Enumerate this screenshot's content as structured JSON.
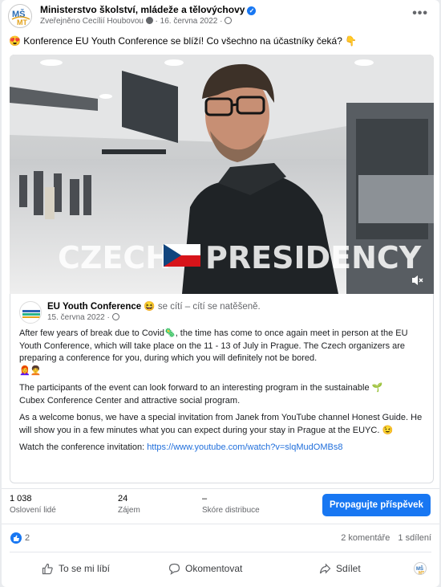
{
  "header": {
    "page_name": "Ministerstvo školství, mládeže a tělovýchovy",
    "published_by": "Zveřejněno Cecílií Houbovou",
    "date": "16. června 2022",
    "more_label": "•••"
  },
  "post_text": "Konference EU Youth Conference se blíží! Co všechno na účastníky čeká?",
  "video": {
    "overlay_left": "CZECH",
    "overlay_right": "PRESIDENCY BOOTH"
  },
  "shared_post": {
    "page_name": "EU Youth Conference",
    "feeling": "se cítí – cítí se natěšeně.",
    "date": "15. června 2022",
    "paragraphs": [
      "After few years of break due to Covid",
      ", the time has come to once again meet in person at the EU Youth Conference, which will take place on the 11 - 13 of July in Prague. The Czech organizers are preparing a conference for you, during which you will definitely not be bored.",
      "The participants of the event can look forward to an interesting program in the sustainable",
      "Cubex Conference Center and attractive social program.",
      "As a welcome bonus, we have a special invitation from Janek from YouTube channel Honest Guide. He will show you in a few minutes what you can expect during your stay in Prague at the EUYC.",
      "Watch the conference invitation:"
    ],
    "link": "https://www.youtube.com/watch?v=slqMudOMBs8"
  },
  "stats": [
    {
      "value": "1 038",
      "label": "Oslovení lidé"
    },
    {
      "value": "24",
      "label": "Zájem"
    },
    {
      "value": "–",
      "label": "Skóre distribuce"
    }
  ],
  "promote_label": "Propagujte příspěvek",
  "reactions": {
    "count": "2",
    "comments": "2 komentáře",
    "shares": "1 sdílení"
  },
  "actions": {
    "like": "To se mi líbí",
    "comment": "Okomentovat",
    "share": "Sdílet"
  },
  "colors": {
    "accent": "#1877f2",
    "link": "#216fdb",
    "muted": "#65676b"
  }
}
